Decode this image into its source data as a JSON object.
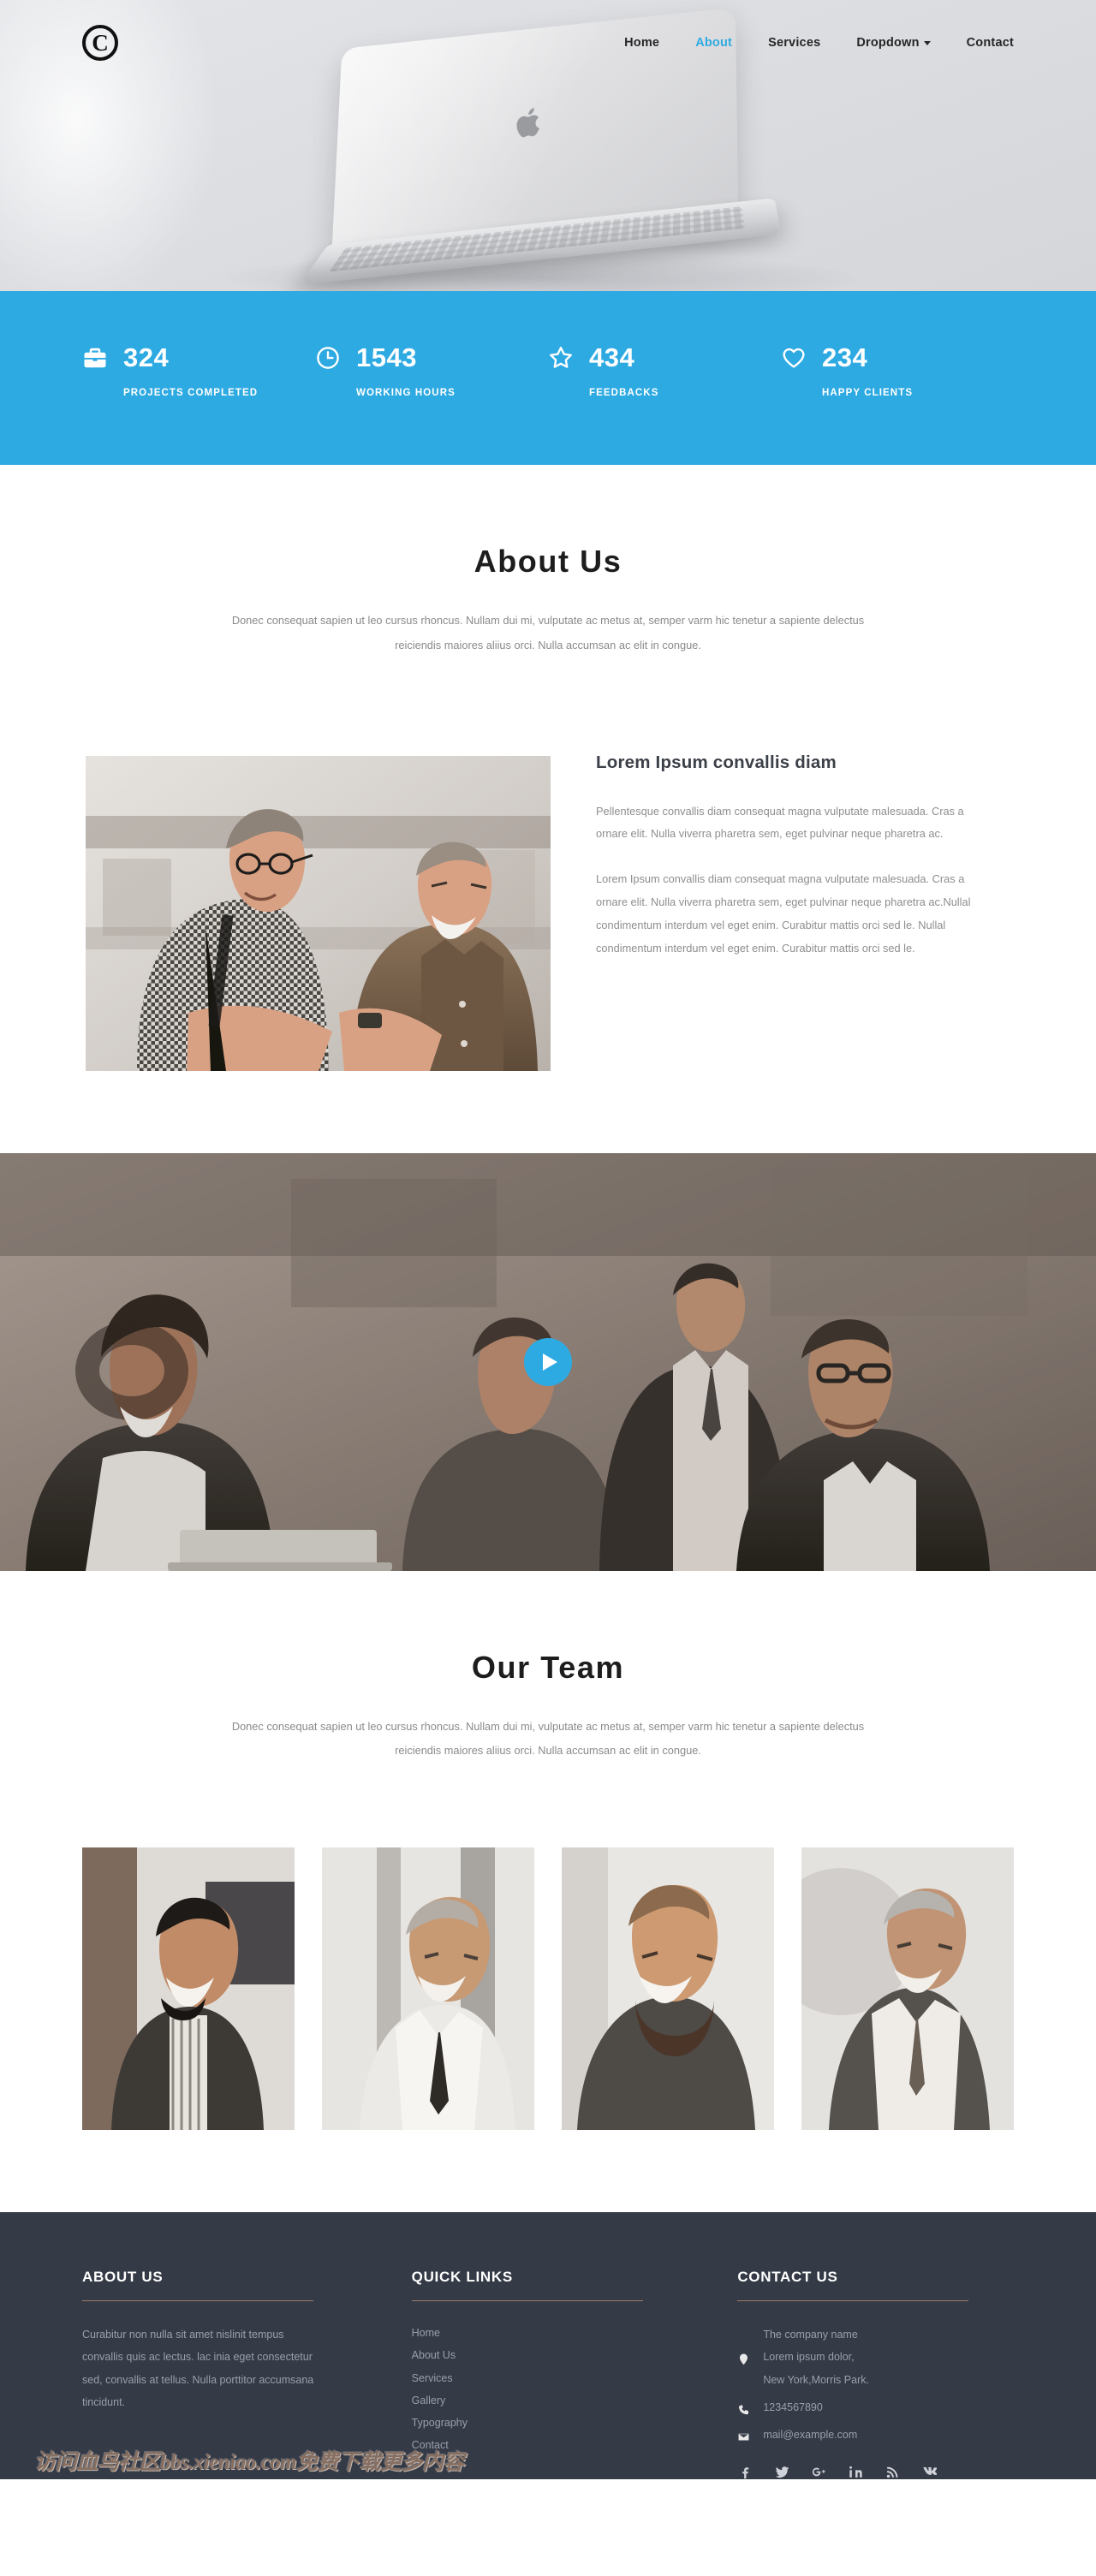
{
  "nav": {
    "logo_letter": "C",
    "links": [
      {
        "label": "Home",
        "active": false,
        "dropdown": false
      },
      {
        "label": "About",
        "active": true,
        "dropdown": false
      },
      {
        "label": "Services",
        "active": false,
        "dropdown": false
      },
      {
        "label": "Dropdown",
        "active": false,
        "dropdown": true
      },
      {
        "label": "Contact",
        "active": false,
        "dropdown": false
      }
    ]
  },
  "stats": {
    "background": "#2eaae2",
    "items": [
      {
        "icon": "briefcase-icon",
        "value": "324",
        "label": "PROJECTS COMPLETED"
      },
      {
        "icon": "clock-icon",
        "value": "1543",
        "label": "WORKING HOURS"
      },
      {
        "icon": "star-icon",
        "value": "434",
        "label": "FEEDBACKS"
      },
      {
        "icon": "heart-icon",
        "value": "234",
        "label": "HAPPY CLIENTS"
      }
    ]
  },
  "about": {
    "title": "About Us",
    "subtitle": "Donec consequat sapien ut leo cursus rhoncus. Nullam dui mi, vulputate ac metus at, semper varm hic tenetur a sapiente delectus reiciendis maiores aliius orci. Nulla accumsan ac elit in congue.",
    "heading": "Lorem Ipsum convallis diam",
    "paragraph1": "Pellentesque convallis diam consequat magna vulputate malesuada. Cras a ornare elit. Nulla viverra pharetra sem, eget pulvinar neque pharetra ac.",
    "paragraph2": "Lorem Ipsum convallis diam consequat magna vulputate malesuada. Cras a ornare elit. Nulla viverra pharetra sem, eget pulvinar neque pharetra ac.Nullal condimentum interdum vel eget enim. Curabitur mattis orci sed le. Nullal condimentum interdum vel eget enim. Curabitur mattis orci sed le."
  },
  "video": {
    "play_label": "play-video"
  },
  "team": {
    "title": "Our Team",
    "subtitle": "Donec consequat sapien ut leo cursus rhoncus. Nullam dui mi, vulputate ac metus at, semper varm hic tenetur a sapiente delectus reiciendis maiores aliius orci. Nulla accumsan ac elit in congue.",
    "members": [
      {
        "name": "team-member-1"
      },
      {
        "name": "team-member-2"
      },
      {
        "name": "team-member-3"
      },
      {
        "name": "team-member-4"
      }
    ]
  },
  "footer": {
    "accent_rule": "#9d7c68",
    "background": "#343a46",
    "about": {
      "title": "ABOUT US",
      "text": "Curabitur non nulla sit amet nislinit tempus convallis quis ac lectus. lac inia eget consectetur sed, convallis at tellus. Nulla porttitor accumsana tincidunt."
    },
    "quick_links": {
      "title": "QUICK LINKS",
      "items": [
        "Home",
        "About Us",
        "Services",
        "Gallery",
        "Typography",
        "Contact"
      ]
    },
    "contact": {
      "title": "CONTACT US",
      "address_icon": "location-pin-icon",
      "address_line1": "The company name",
      "address_line2": "Lorem ipsum dolor,",
      "address_line3": "New York,Morris Park.",
      "phone_icon": "phone-icon",
      "phone": "1234567890",
      "mail_icon": "envelope-icon",
      "mail": "mail@example.com",
      "social": [
        {
          "icon": "facebook-icon"
        },
        {
          "icon": "twitter-icon"
        },
        {
          "icon": "google-plus-icon"
        },
        {
          "icon": "linkedin-icon"
        },
        {
          "icon": "rss-icon"
        },
        {
          "icon": "vk-icon"
        }
      ]
    }
  },
  "watermark": {
    "text": "访问血鸟社区bbs.xieniao.com免费下载更多内容"
  }
}
